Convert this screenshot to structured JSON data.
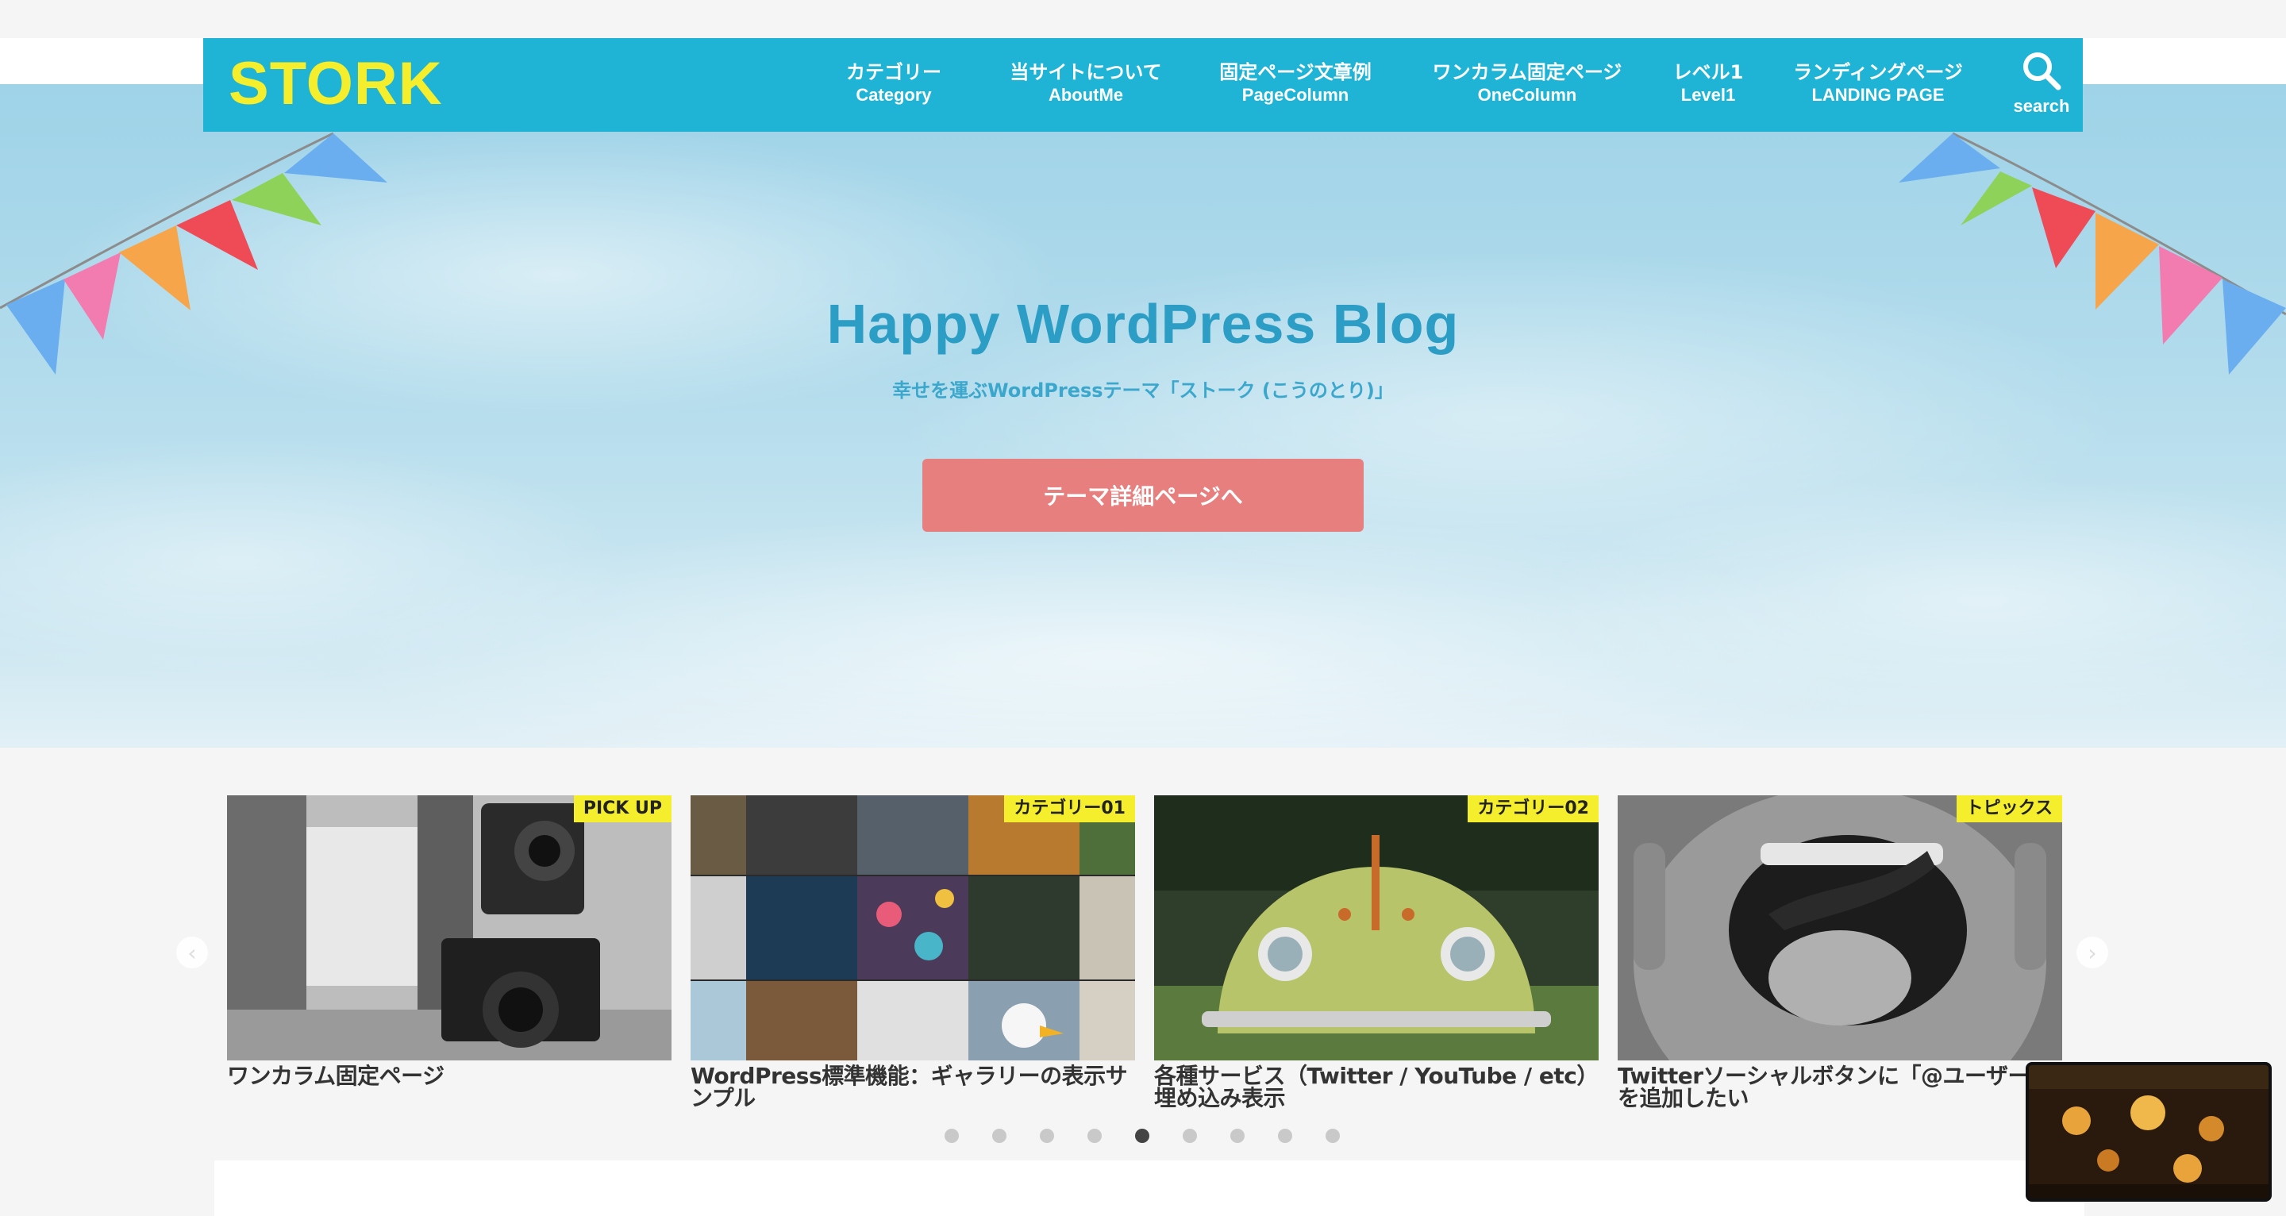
{
  "header": {
    "logo": "STORK",
    "nav": [
      {
        "jp": "カテゴリー",
        "en": "Category"
      },
      {
        "jp": "当サイトについて",
        "en": "AboutMe"
      },
      {
        "jp": "固定ページ文章例",
        "en": "PageColumn"
      },
      {
        "jp": "ワンカラム固定ページ",
        "en": "OneColumn"
      },
      {
        "jp": "レベル1",
        "en": "Level1"
      },
      {
        "jp": "ランディングページ",
        "en": "LANDING PAGE"
      }
    ],
    "search_label": "search",
    "search_icon": "magnifier-icon"
  },
  "hero": {
    "title": "Happy WordPress Blog",
    "subtitle": "幸せを運ぶWordPressテーマ「ストーク (こうのとり)」",
    "button_label": "テーマ詳細ページへ",
    "button_color": "#e87f7f"
  },
  "carousel": {
    "cards": [
      {
        "badge": "PICK UP",
        "title": "ワンカラム固定ページ"
      },
      {
        "badge": "カテゴリー01",
        "title": "WordPress標準機能：ギャラリーの表示サンプル"
      },
      {
        "badge": "カテゴリー02",
        "title": "各種サービス（Twitter / YouTube / etc）埋め込み表示"
      },
      {
        "badge": "トピックス",
        "title": "Twitterソーシャルボタンに「@ユーザー名」を追加したい"
      }
    ],
    "dot_count": 9,
    "active_dot": 5,
    "prev_icon": "chevron-left-icon",
    "next_icon": "chevron-right-icon"
  },
  "colors": {
    "header_bg": "#1fb4d6",
    "logo": "#f5ee2c",
    "hero_title": "#2c9dc4",
    "badge_bg": "#f5ee2c"
  }
}
